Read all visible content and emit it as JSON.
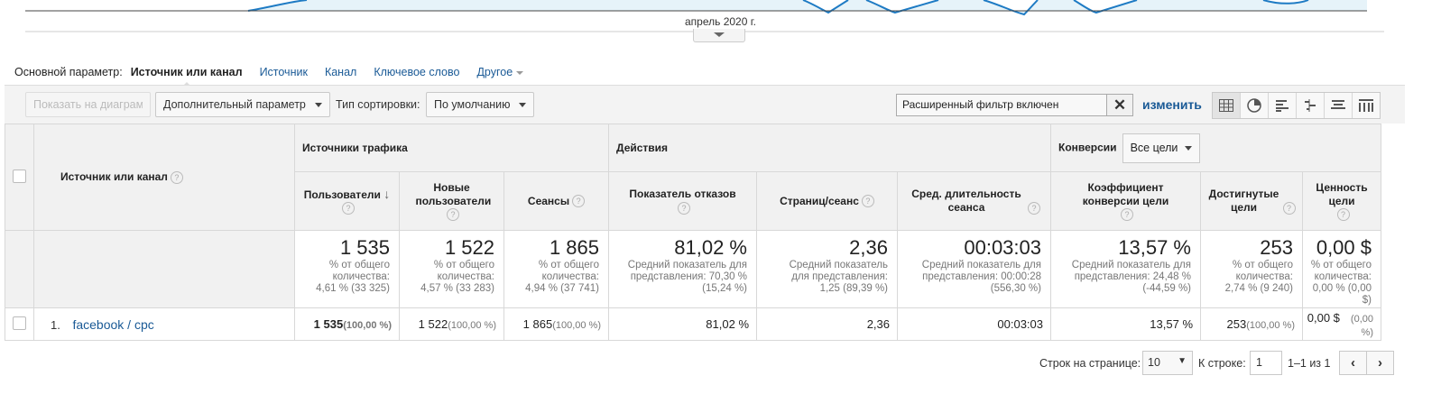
{
  "chart": {
    "date_label": "апрель 2020 г."
  },
  "primary_dimension": {
    "label": "Основной параметр:",
    "active": "Источник или канал",
    "options": [
      "Источник",
      "Канал",
      "Ключевое слово"
    ],
    "other": "Другое"
  },
  "toolbar": {
    "plot_rows": "Показать на диаграмме",
    "secondary_dimension": "Дополнительный параметр",
    "sort_type_label": "Тип сортировки:",
    "sort_type_value": "По умолчанию",
    "filter_text": "Расширенный фильтр включен",
    "edit_link": "изменить",
    "view_icons": [
      "table-view-icon",
      "pie-view-icon",
      "performance-view-icon",
      "comparison-view-icon",
      "term-cloud-view-icon",
      "pivot-view-icon"
    ]
  },
  "table": {
    "dimension_header": "Источник или канал",
    "groups": {
      "acquisition": "Источники трафика",
      "behavior": "Действия",
      "conversions": "Конверсии",
      "goal_select": "Все цели"
    },
    "columns": [
      "Пользователи",
      "Новые пользователи",
      "Сеансы",
      "Показатель отказов",
      "Страниц/сеанс",
      "Сред. длительность сеанса",
      "Коэффициент конверсии цели",
      "Достигнутые цели",
      "Ценность цели"
    ],
    "totals": [
      {
        "value": "1 535",
        "sub": [
          "% от общего",
          "количества:",
          "4,61 % (33 325)"
        ]
      },
      {
        "value": "1 522",
        "sub": [
          "% от общего",
          "количества:",
          "4,57 % (33 283)"
        ]
      },
      {
        "value": "1 865",
        "sub": [
          "% от общего",
          "количества:",
          "4,94 % (37 741)"
        ]
      },
      {
        "value": "81,02 %",
        "sub": [
          "Средний показатель для",
          "представления: 70,30 %",
          "(15,24 %)"
        ]
      },
      {
        "value": "2,36",
        "sub": [
          "Средний показатель",
          "для представления:",
          "1,25 (89,39 %)"
        ]
      },
      {
        "value": "00:03:03",
        "sub": [
          "Средний показатель для",
          "представления: 00:00:28",
          "(556,30 %)"
        ]
      },
      {
        "value": "13,57 %",
        "sub": [
          "Средний показатель для",
          "представления: 24,48 %",
          "(-44,59 %)"
        ]
      },
      {
        "value": "253",
        "sub": [
          "% от общего",
          "количества:",
          "2,74 % (9 240)"
        ]
      },
      {
        "value": "0,00 $",
        "sub": [
          "% от общего",
          "количества:",
          "0,00 % (0,00 $)"
        ]
      }
    ],
    "rows": [
      {
        "index": "1.",
        "dimension": "facebook / cpc",
        "cells": [
          {
            "value": "1 535",
            "pct": "(100,00 %)"
          },
          {
            "value": "1 522",
            "pct": "(100,00 %)"
          },
          {
            "value": "1 865",
            "pct": "(100,00 %)"
          },
          {
            "value": "81,02 %",
            "pct": ""
          },
          {
            "value": "2,36",
            "pct": ""
          },
          {
            "value": "00:03:03",
            "pct": ""
          },
          {
            "value": "13,57 %",
            "pct": ""
          },
          {
            "value": "253",
            "pct": "(100,00 %)"
          },
          {
            "value": "0,00 $",
            "pct": "(0,00 %)"
          }
        ]
      }
    ]
  },
  "pagination": {
    "rows_per_page_label": "Строк на странице:",
    "rows_per_page": "10",
    "goto_label": "К строке:",
    "goto_value": "1",
    "range": "1–1 из 1"
  },
  "colors": {
    "link": "#1a5a96",
    "line": "#1e7bc4",
    "area": "#e6f3f9"
  }
}
